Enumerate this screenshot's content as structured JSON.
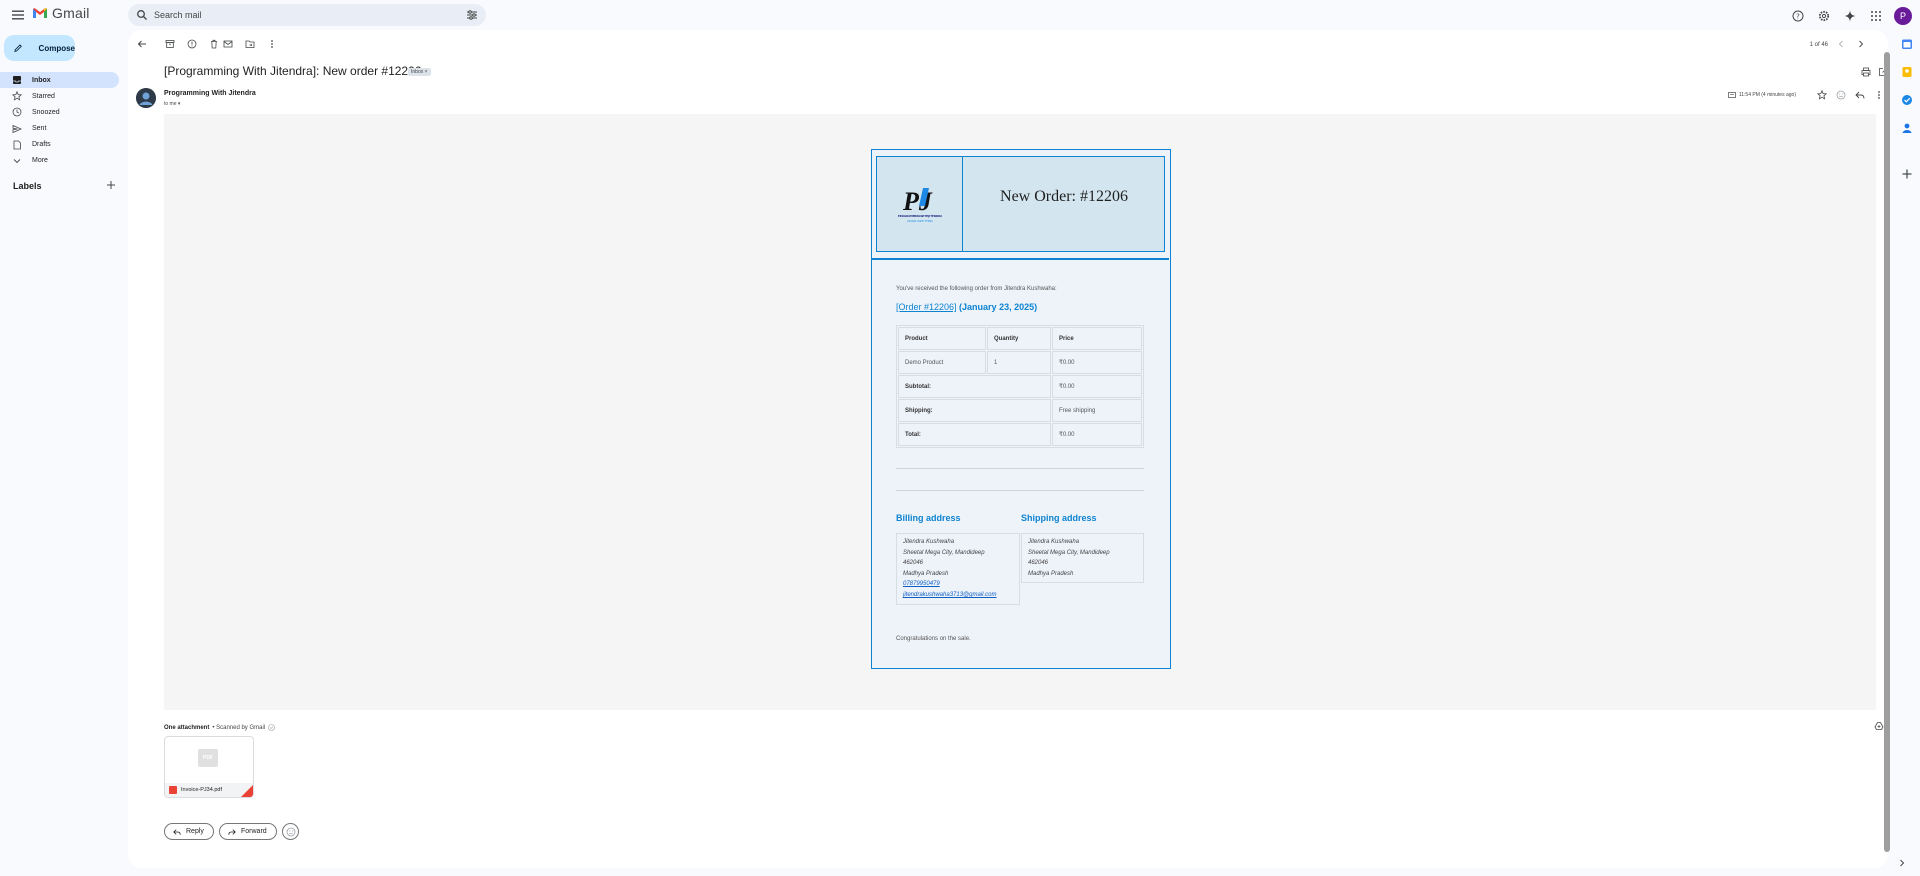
{
  "app": {
    "name": "Gmail",
    "search_placeholder": "Search mail",
    "avatar_letter": "P",
    "brand_colors": {
      "red": "#ea4335",
      "blue": "#4285f4",
      "yellow": "#fbbc04",
      "green": "#34a853"
    }
  },
  "sidebar": {
    "compose_label": "Compose",
    "items": [
      {
        "label": "Inbox",
        "icon": "inbox-icon",
        "active": true
      },
      {
        "label": "Starred",
        "icon": "star-icon"
      },
      {
        "label": "Snoozed",
        "icon": "clock-icon"
      },
      {
        "label": "Sent",
        "icon": "send-icon"
      },
      {
        "label": "Drafts",
        "icon": "draft-icon"
      },
      {
        "label": "More",
        "icon": "chevron-down-icon"
      }
    ],
    "labels_heading": "Labels"
  },
  "toolbar": {
    "pager_text": "1 of 46"
  },
  "message": {
    "subject": "[Programming With Jitendra]: New order #12206",
    "label_chip": "Inbox ×",
    "sender": "Programming With Jitendra",
    "to_line": "to me ▾",
    "time": "11:54 PM (4 minutes ago)"
  },
  "email_body": {
    "logo_text": "PJ",
    "logo_caption1": "PROGRAMMINGWITHJITENDRA",
    "logo_caption2": "LEARN CODE THINK",
    "title": "New Order: #12206",
    "intro": "You've received the following order from Jitendra Kushwaha:",
    "order_link": "[Order #12206]",
    "order_date": " (January 23, 2025)",
    "table_headers": [
      "Product",
      "Quantity",
      "Price"
    ],
    "product_row": [
      "Demo Product",
      "1",
      "₹0.00"
    ],
    "totals": [
      {
        "label": "Subtotal:",
        "value": "₹0.00"
      },
      {
        "label": "Shipping:",
        "value": "Free shipping"
      },
      {
        "label": "Total:",
        "value": "₹0.00"
      }
    ],
    "billing_title": "Billing address",
    "billing_lines": [
      "Jitendra Kushwaha",
      "Sheetal Mega City, Mandideep",
      "462046",
      "Madhya Pradesh"
    ],
    "billing_phone": "07879950479",
    "billing_email": "jitendrakushwaha3713@gmail.com",
    "shipping_title": "Shipping address",
    "shipping_lines": [
      "Jitendra Kushwaha",
      "Sheetal Mega City, Mandideep",
      "462046",
      "Madhya Pradesh"
    ],
    "closing": "Congratulations on the sale."
  },
  "attachments": {
    "heading": "One attachment",
    "scanned": "• Scanned by Gmail",
    "file_name": "Invoice-PJ34.pdf",
    "thumb_label": "PDF"
  },
  "actions": {
    "reply": "Reply",
    "forward": "Forward"
  }
}
